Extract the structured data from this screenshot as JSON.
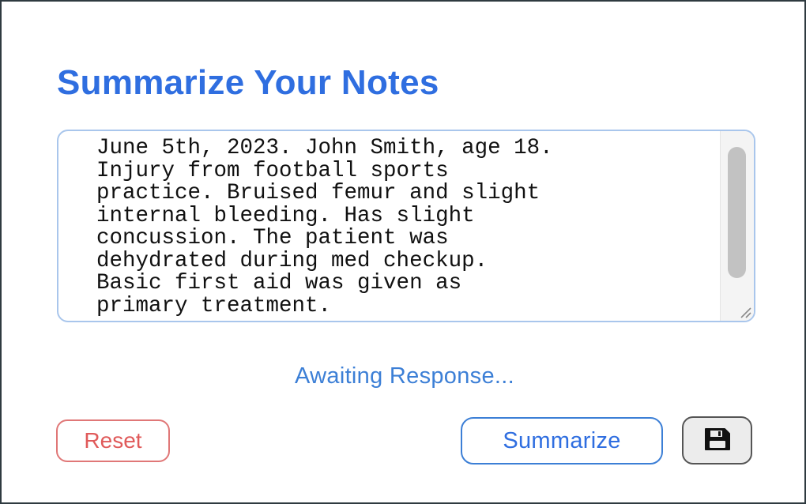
{
  "header": {
    "title": "Summarize Your Notes"
  },
  "notes": {
    "value": "June 5th, 2023. John Smith, age 18.\nInjury from football sports\npractice. Bruised femur and slight\ninternal bleeding. Has slight\nconcussion. The patient was\ndehydrated during med checkup.\nBasic first aid was given as\nprimary treatment."
  },
  "status": {
    "text": "Awaiting Response..."
  },
  "actions": {
    "reset_label": "Reset",
    "summarize_label": "Summarize",
    "save_icon": "floppy-disk-icon"
  },
  "colors": {
    "accent": "#2f6ee0",
    "status": "#3c7fd6",
    "reset": "#e05a5a",
    "notes_border": "#a9c6ec"
  }
}
